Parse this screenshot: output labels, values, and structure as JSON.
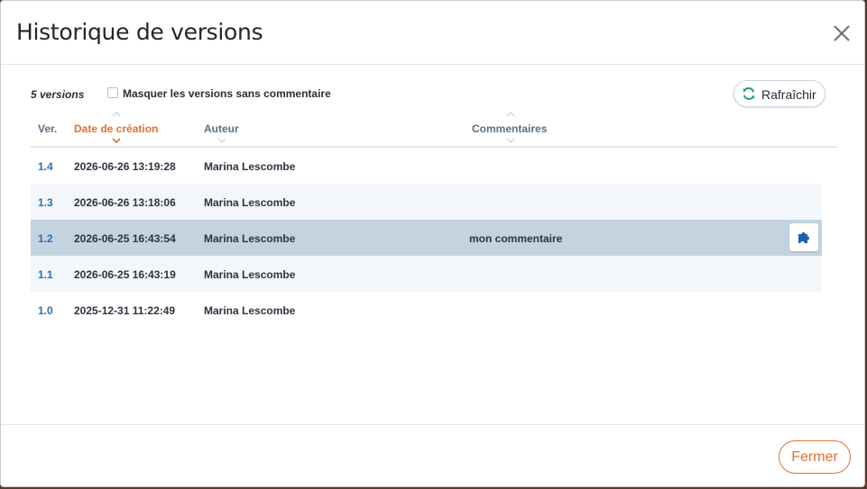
{
  "dialog": {
    "title": "Historique de versions",
    "close_icon": "close-icon"
  },
  "toolbar": {
    "count_label": "5 versions",
    "hide_checkbox_label": "Masquer les versions sans commentaire",
    "hide_checkbox_checked": false,
    "refresh_label": "Rafraîchir",
    "refresh_icon": "refresh-icon"
  },
  "table": {
    "columns": [
      {
        "label": "Ver.",
        "sortable": false
      },
      {
        "label": "Date de création",
        "sortable": true,
        "active": true,
        "sort": "descending"
      },
      {
        "label": "Auteur",
        "sortable": true
      },
      {
        "label": "Commentaires",
        "sortable": true
      }
    ],
    "rows": [
      {
        "version": "1.4",
        "date": "2026-06-26 13:19:28",
        "author": "Marina Lescombe",
        "comment": ""
      },
      {
        "version": "1.3",
        "date": "2026-06-26 13:18:06",
        "author": "Marina Lescombe",
        "comment": ""
      },
      {
        "version": "1.2",
        "date": "2026-06-25 16:43:54",
        "author": "Marina Lescombe",
        "comment": "mon commentaire",
        "selected": true,
        "action_icon": "puzzle-icon"
      },
      {
        "version": "1.1",
        "date": "2026-06-25 16:43:19",
        "author": "Marina Lescombe",
        "comment": ""
      },
      {
        "version": "1.0",
        "date": "2025-12-31 11:22:49",
        "author": "Marina Lescombe",
        "comment": ""
      }
    ]
  },
  "footer": {
    "close_label": "Fermer"
  },
  "colors": {
    "accent": "#e1722e",
    "link": "#2a6fb5",
    "selected_row": "#c3d3e0",
    "alt_row": "#f3f6fa",
    "refresh_icon": "#1aa08a",
    "plugin_icon": "#1b5fb3"
  }
}
